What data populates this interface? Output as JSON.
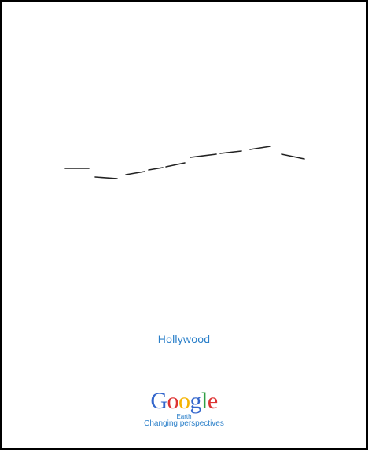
{
  "caption": "Hollywood",
  "logo": {
    "letters": [
      {
        "char": "G",
        "color": "#3366cc"
      },
      {
        "char": "o",
        "color": "#dd3333"
      },
      {
        "char": "o",
        "color": "#f5b400"
      },
      {
        "char": "g",
        "color": "#3366cc"
      },
      {
        "char": "l",
        "color": "#2f9e44"
      },
      {
        "char": "e",
        "color": "#dd3333"
      }
    ],
    "product": "Earth"
  },
  "tagline": "Changing perspectives",
  "colors": {
    "text_accent": "#2a7fc9",
    "dash": "#222222"
  }
}
